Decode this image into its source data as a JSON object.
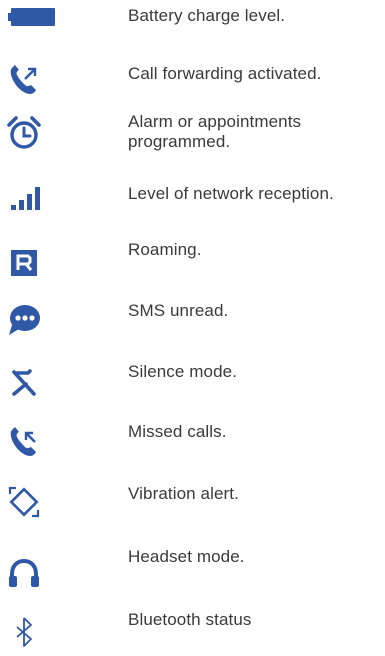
{
  "legend": {
    "items": [
      {
        "icon": "battery-icon",
        "label": "Battery charge level."
      },
      {
        "icon": "call-forwarding-icon",
        "label": "Call forwarding activated."
      },
      {
        "icon": "alarm-clock-icon",
        "label": "Alarm or appointments programmed."
      },
      {
        "icon": "signal-strength-icon",
        "label": "Level of network reception."
      },
      {
        "icon": "roaming-icon",
        "label": "Roaming."
      },
      {
        "icon": "sms-unread-icon",
        "label": "SMS unread."
      },
      {
        "icon": "silence-mode-icon",
        "label": "Silence mode."
      },
      {
        "icon": "missed-call-icon",
        "label": "Missed calls."
      },
      {
        "icon": "vibration-icon",
        "label": "Vibration alert."
      },
      {
        "icon": "headset-icon",
        "label": "Headset mode."
      },
      {
        "icon": "bluetooth-icon",
        "label": "Bluetooth status"
      }
    ]
  },
  "colors": {
    "icon": "#2f58a6",
    "text": "#3a3a3a",
    "background": "#ffffff"
  }
}
